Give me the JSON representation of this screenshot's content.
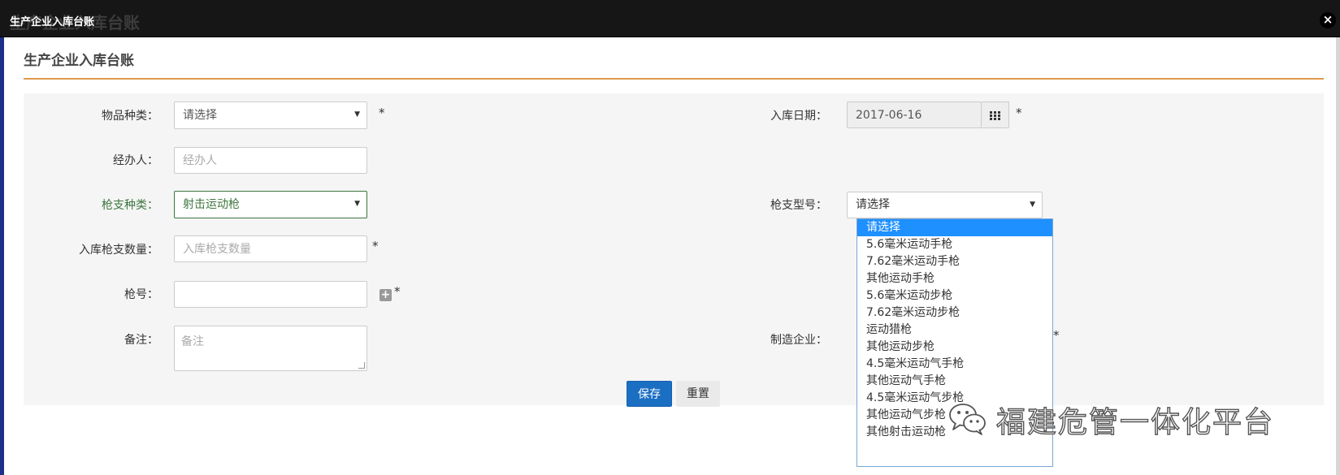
{
  "window": {
    "title": "生产企业入库台账",
    "ghost_title": "生产企业入库台账",
    "close_label": "×"
  },
  "page": {
    "title": "生产企业入库台账"
  },
  "form": {
    "item_type": {
      "label": "物品种类：",
      "value": "请选择",
      "required": "*"
    },
    "storage_date": {
      "label": "入库日期：",
      "value": "2017-06-16",
      "required": "*"
    },
    "handler": {
      "label": "经办人：",
      "placeholder": "经办人"
    },
    "gun_type": {
      "label": "枪支种类：",
      "value": "射击运动枪"
    },
    "gun_model": {
      "label": "枪支型号：",
      "value": "请选择"
    },
    "quantity": {
      "label": "入库枪支数量：",
      "placeholder": "入库枪支数量",
      "required": "*"
    },
    "gun_number": {
      "label": "枪号：",
      "value": "",
      "add_label": "+",
      "required": "*"
    },
    "remarks": {
      "label": "备注：",
      "placeholder": "备注"
    },
    "manufacturer": {
      "label": "制造企业：",
      "required": "*"
    }
  },
  "buttons": {
    "save": "保存",
    "reset": "重置"
  },
  "gun_model_options": [
    "请选择",
    "5.6毫米运动手枪",
    "7.62毫米运动手枪",
    "其他运动手枪",
    "5.6毫米运动步枪",
    "7.62毫米运动步枪",
    "运动猎枪",
    "其他运动步枪",
    "4.5毫米运动气手枪",
    "其他运动气手枪",
    "4.5毫米运动气步枪",
    "其他运动气步枪",
    "其他射击运动枪"
  ],
  "selected_option_index": 0,
  "watermark": {
    "text": "福建危管一体化平台",
    "icon": "wechat-icon"
  },
  "colors": {
    "accent_rule": "#e0994c",
    "primary_button": "#1b6fc3",
    "selected_option": "#1e90ff",
    "valid_green": "#3c763d"
  }
}
